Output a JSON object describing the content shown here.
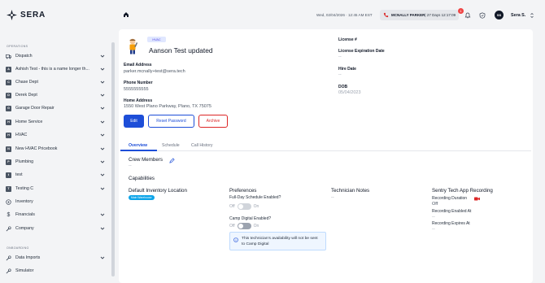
{
  "brand": {
    "name": "SERA"
  },
  "sidebar": {
    "operations_label": "OPERATIONS",
    "onboarding_label": "ONBOARDING",
    "items": [
      {
        "label": "Dispatch",
        "badge": "",
        "icon": "truck-icon",
        "chevron": true
      },
      {
        "label": "Ashish Test - this is a name longer th...",
        "badge": "A",
        "chevron": true
      },
      {
        "label": "Chase Dept",
        "badge": "C",
        "chevron": true
      },
      {
        "label": "Derek Dept",
        "badge": "D",
        "chevron": true
      },
      {
        "label": "Garage Door Repair",
        "badge": "G",
        "chevron": true
      },
      {
        "label": "Home Service",
        "badge": "H",
        "chevron": true
      },
      {
        "label": "HVAC",
        "badge": "H",
        "chevron": true
      },
      {
        "label": "New HVAC Pricebook",
        "badge": "N",
        "chevron": true
      },
      {
        "label": "Plumbing",
        "badge": "P",
        "chevron": true
      },
      {
        "label": "test",
        "badge": "t",
        "chevron": true
      },
      {
        "label": "Testing C",
        "badge": "T",
        "chevron": true
      },
      {
        "label": "Inventory",
        "badge": "",
        "icon": "box-icon",
        "chevron": false
      },
      {
        "label": "Financials",
        "badge": "",
        "icon": "dollar-icon",
        "chevron": true
      },
      {
        "label": "Company",
        "badge": "",
        "icon": "wrench-icon",
        "chevron": true
      }
    ],
    "onboarding_items": [
      {
        "label": "Data Imports",
        "icon": "wrench-icon",
        "chevron": true
      },
      {
        "label": "Simulator",
        "icon": "wrench-icon",
        "chevron": false
      }
    ]
  },
  "topbar": {
    "datetime": "Wed, 02/04/2026 · 12:45 AM EST",
    "tech_name": "MCNALLY PARKER",
    "tech_status": " | 27 Days 12:17:09",
    "notification_count": "1",
    "user_initials": "SS",
    "user_name": "Sera S."
  },
  "profile": {
    "skill": "HVAC",
    "name": "Aanson Test updated",
    "email_label": "Email Address",
    "email": "parker.mcnally+test@sera.tech",
    "phone_label": "Phone Number",
    "phone": "5555555555",
    "address_label": "Home Address",
    "address": "1550 West Plano Parkway, Plano, TX 75075",
    "license_label": "License #",
    "license_value": "",
    "license_exp_label": "License Expiration Date",
    "license_exp_value": "--",
    "hire_label": "Hire Date",
    "hire_value": "--",
    "dob_label": "DOB",
    "dob_value": "05/04/2023"
  },
  "actions": {
    "edit": "Edit",
    "reset": "Reset Password",
    "archive": "Archive"
  },
  "tabs": [
    "Overview",
    "Schedule",
    "Call History"
  ],
  "overview": {
    "crew_title": "Crew Members",
    "crew_value": "--",
    "capabilities_title": "Capabilities",
    "inventory_title": "Default Inventory Location",
    "inventory_chip": "Main Warehouse",
    "preferences_title": "Preferences",
    "full_day_label": "Full-Day Schedule Enabled?",
    "camp_label": "Camp Digital Enabled?",
    "off": "Off",
    "on": "On",
    "info_text": "This technician's availability will not be sent to Camp Digital",
    "notes_title": "Technician Notes",
    "notes_value": "--",
    "recording_title": "Sentry Tech App Recording",
    "rec_duration_label": "Recording Duration",
    "rec_duration_value": "Off",
    "rec_enabled_label": "Recording Enabled At",
    "rec_enabled_value": "--",
    "rec_expires_label": "Recording Expires At",
    "rec_expires_value": "--"
  },
  "colors": {
    "primary": "#1d4ed8",
    "danger": "#dc2626",
    "chip": "#0ea5e9"
  }
}
